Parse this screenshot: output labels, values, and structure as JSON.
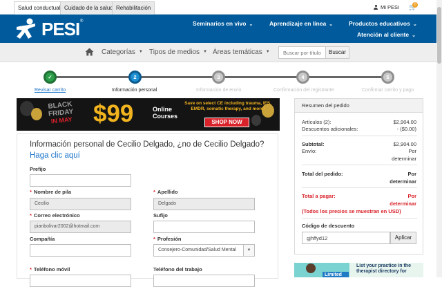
{
  "top_tabs": [
    {
      "label": "Salud conductual",
      "active": true
    },
    {
      "label": "Cuidado de la salud",
      "active": false
    },
    {
      "label": "Rehabilitación",
      "active": false
    }
  ],
  "account": {
    "label": "Mi PESI",
    "icon": "user-icon"
  },
  "cart": {
    "icon": "cart-icon",
    "count": "0"
  },
  "brand": {
    "logo_text": "PESI",
    "registered": "®",
    "color": "#005a9c"
  },
  "main_nav": [
    {
      "label": "Seminarios en vivo"
    },
    {
      "label": "Aprendizaje en línea"
    },
    {
      "label": "Productos educativos"
    },
    {
      "label": "Atención al cliente"
    }
  ],
  "sub_nav": {
    "home_icon": "home-icon",
    "items": [
      {
        "label": "Categorías"
      },
      {
        "label": "Tipos de medios"
      },
      {
        "label": "Áreas temáticas"
      }
    ],
    "search_placeholder": "Buscar por título, tema u orador",
    "search_button": "Buscar"
  },
  "steps": [
    {
      "number": "✓",
      "label": "Revisar carrito",
      "state": "done"
    },
    {
      "number": "2",
      "label": "Información personal",
      "state": "current"
    },
    {
      "number": "3",
      "label": "Información de envío",
      "state": "todo"
    },
    {
      "number": "4",
      "label": "Confirmación del registrante",
      "state": "todo"
    },
    {
      "number": "5",
      "label": "Confirmar carrito y pago",
      "state": "todo"
    }
  ],
  "banner": {
    "black": "BLACK",
    "friday": "FRIDAY",
    "in_may": "IN MAY",
    "price": "$99",
    "online": "Online",
    "courses": "Courses",
    "description": "Save on select CE including trauma, IFS, EMDR, somatic therapy, and more!",
    "cta": "SHOP NOW"
  },
  "form": {
    "title": "Información personal de Cecilio Delgado, ¿no de Cecilio Delgado?",
    "link": "Haga clic aquí",
    "prefix": {
      "label": "Prefijo",
      "value": ""
    },
    "first_name": {
      "label": "Nombre de pila",
      "value": "Cecilio"
    },
    "last_name": {
      "label": "Apellido",
      "value": "Delgado"
    },
    "email": {
      "label": "Correo electrónico",
      "value": "pianbolivar2002@hotmail.com"
    },
    "suffix": {
      "label": "Sufijo",
      "value": ""
    },
    "company": {
      "label": "Compañía",
      "value": ""
    },
    "profession": {
      "label": "Profesión",
      "value": "Consejero-Comunidad/Salud Mental"
    },
    "mobile": {
      "label": "Teléfono móvil"
    },
    "work_phone": {
      "label": "Teléfono del trabajo"
    },
    "required_marker": "*"
  },
  "summary": {
    "title": "Resumen del pedido",
    "items_label": "Artículos (2):",
    "items_value": "$2,904.00",
    "discounts_label": "Descuentos adicionales:",
    "discounts_value": "- ($0.00)",
    "subtotal_label": "Subtotal:",
    "subtotal_value": "$2,904.00",
    "shipping_label": "Envío:",
    "shipping_value_1": "Por",
    "shipping_value_2": "determinar",
    "total_label": "Total del pedido:",
    "total_value_1": "Por",
    "total_value_2": "determinar",
    "pay_label": "Total a pagar:",
    "pay_value_1": "Por",
    "pay_value_2": "determinar",
    "usd_note": "(Todos los precios se muestran en USD)",
    "discount_label": "Código de descuento",
    "discount_value": "gjhffyd12",
    "apply_button": "Aplicar"
  },
  "ad": {
    "limited": "Limited",
    "line1": "List your practice in the",
    "line2": "therapist directory for"
  }
}
